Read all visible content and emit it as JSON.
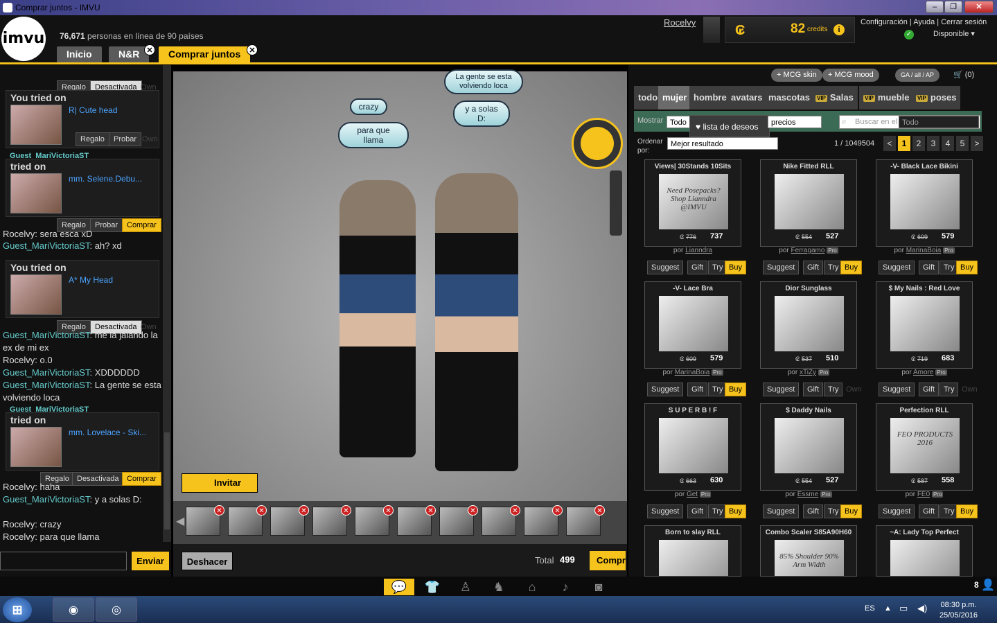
{
  "window": {
    "title": "Comprar juntos - IMVU",
    "minimize": "–",
    "maximize": "❐",
    "close": "✕"
  },
  "header": {
    "logo": "imvu",
    "online_count": "76,671",
    "online_text": "personas en línea de 90 países",
    "username": "Rocelvy",
    "credits": "82",
    "credits_label": "credits",
    "credit_symbol": "₢",
    "info": "i",
    "links": "Configuración  |  Ayuda  |  Cerrar sesión",
    "status": "Disponible",
    "status_check": "✓"
  },
  "tabs": [
    {
      "label": "Inicio"
    },
    {
      "label": "N&R"
    },
    {
      "label": "Comprar juntos"
    }
  ],
  "tab_close": "✕",
  "chat": {
    "top_buttons": {
      "gift": "Regalo",
      "deactivated": "Desactivada",
      "own": "Own"
    },
    "cards": [
      {
        "header": "You tried on",
        "guest": "",
        "item": "R| Cute head",
        "b1": "Regalo",
        "b2": "Probar",
        "b3": "Own"
      },
      {
        "header": "tried on",
        "guest": "Guest_MariVictoriaST",
        "item": "mm. Selene.Debu...",
        "b1": "Regalo",
        "b2": "Probar",
        "b3": "Comprar"
      },
      {
        "header": "You tried on",
        "guest": "",
        "item": "A* My Head",
        "b1": "Regalo",
        "b2": "Desactivada",
        "b3": "Own"
      },
      {
        "header": "tried on",
        "guest": "Guest_MariVictoriaST",
        "item": "mm. Lovelace - Ski...",
        "b1": "Regalo",
        "b2": "Desactivada",
        "b3": "Comprar"
      }
    ],
    "lines": [
      {
        "user": "Rocelvy",
        "text": " sera esca xD"
      },
      {
        "user": "Guest_MariVictoriaST",
        "text": " ah? xd"
      },
      {
        "user": "Guest_MariVictoriaST",
        "text": " me la jalando la ex de mi ex"
      },
      {
        "user": "Rocelvy",
        "text": " o.0"
      },
      {
        "user": "Guest_MariVictoriaST",
        "text": " XDDDDDD"
      },
      {
        "user": "Guest_MariVictoriaST",
        "text": " La gente se esta volviendo loca"
      },
      {
        "user": "Rocelvy",
        "text": " haha"
      },
      {
        "user": "Guest_MariVictoriaST",
        "text": " y a solas D:"
      },
      {
        "user": "Rocelvy",
        "text": " crazy"
      },
      {
        "user": "Rocelvy",
        "text": " para que llama"
      }
    ],
    "send": "Enviar"
  },
  "scene": {
    "bubbles": [
      "crazy",
      "para que llama",
      "La gente se esta volviendo loca",
      "y a solas D:"
    ],
    "invite": "Invitar",
    "undo": "Deshacer",
    "total_label": "Total",
    "total_value": "499",
    "buy": "Comprar"
  },
  "catalog": {
    "pills": [
      "+ MCG skin",
      "+ MCG mood",
      "GA / all / AP",
      "(0)"
    ],
    "categories": [
      "todo",
      "mujer",
      "hombre",
      "avatars",
      "mascotas",
      "Salas",
      "mueble",
      "poses"
    ],
    "vip": "VIP",
    "wishlist": "lista de deseos",
    "show_label": "Mostrar",
    "show_value": "Todo",
    "prices": "precios",
    "search_placeholder": "Buscar en el catálogo",
    "search_scope": "Todo",
    "order_label": "Ordenar por:",
    "order_value": "Mejor resultado",
    "page_info": "1 / 1049504",
    "pages": [
      "<",
      "1",
      "2",
      "3",
      "4",
      "5",
      ">"
    ],
    "by": "por",
    "pro": "Pro",
    "actions": {
      "suggest": "Suggest",
      "gift": "Gift",
      "try": "Try",
      "buy": "Buy",
      "own": "Own"
    },
    "products": [
      {
        "title": "Views| 30Stands 10Sits",
        "old": "776",
        "price": "737",
        "author": "Lianndra",
        "pro": false,
        "own": false,
        "img": "Need Posepacks? Shop Lianndra @IMVU"
      },
      {
        "title": "Nike Fitted RLL",
        "old": "554",
        "price": "527",
        "author": "Ferragamo",
        "pro": true,
        "own": false,
        "img": ""
      },
      {
        "title": "-V- Black Lace Bikini",
        "old": "609",
        "price": "579",
        "author": "MarinaBoia",
        "pro": true,
        "own": false,
        "img": ""
      },
      {
        "title": "-V- Lace Bra",
        "old": "609",
        "price": "579",
        "author": "MarinaBoia",
        "pro": true,
        "own": false,
        "img": ""
      },
      {
        "title": "Dior Sunglass",
        "old": "537",
        "price": "510",
        "author": "xTiZy",
        "pro": true,
        "own": true,
        "img": ""
      },
      {
        "title": "$ My Nails : Red Love",
        "old": "719",
        "price": "683",
        "author": "Amore",
        "pro": true,
        "own": true,
        "img": ""
      },
      {
        "title": "S U P E R B ! F",
        "old": "663",
        "price": "630",
        "author": "Get",
        "pro": true,
        "own": false,
        "img": ""
      },
      {
        "title": "$ Daddy Nails",
        "old": "554",
        "price": "527",
        "author": "Essme",
        "pro": true,
        "own": false,
        "img": ""
      },
      {
        "title": "Perfection RLL",
        "old": "587",
        "price": "558",
        "author": "FE0",
        "pro": true,
        "own": false,
        "img": "FEO PRODUCTS 2016"
      },
      {
        "title": "Born to slay RLL",
        "old": "",
        "price": "",
        "author": "",
        "pro": false,
        "own": false,
        "img": ""
      },
      {
        "title": "Combo Scaler S85A90H60",
        "old": "",
        "price": "",
        "author": "",
        "pro": false,
        "own": false,
        "img": "85% Shoulder 90% Arm Width"
      },
      {
        "title": "~A: Lady Top Perfect",
        "old": "",
        "price": "",
        "author": "",
        "pro": false,
        "own": false,
        "img": ""
      }
    ]
  },
  "bottom": {
    "count": "8"
  },
  "taskbar": {
    "lang": "ES",
    "time": "08:30 p.m.",
    "date": "25/05/2016"
  }
}
